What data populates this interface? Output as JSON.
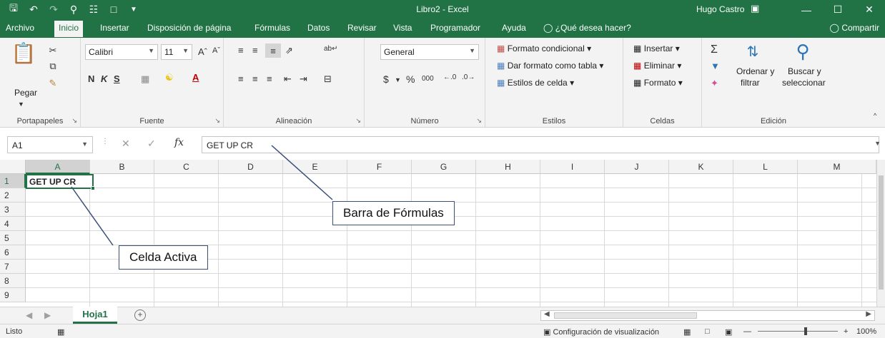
{
  "window": {
    "title": "Libro2  -  Excel",
    "user": "Hugo Castro",
    "controls": [
      "—",
      "☐",
      "✕"
    ]
  },
  "qat": [
    "🖫",
    "↶",
    "↷",
    "⌖",
    "🔍",
    "🗋",
    "⏷"
  ],
  "tabs": [
    {
      "label": "Archivo",
      "active": false
    },
    {
      "label": "Inicio",
      "active": true
    },
    {
      "label": "Insertar",
      "active": false
    },
    {
      "label": "Disposición de página",
      "active": false
    },
    {
      "label": "Fórmulas",
      "active": false
    },
    {
      "label": "Datos",
      "active": false
    },
    {
      "label": "Revisar",
      "active": false
    },
    {
      "label": "Vista",
      "active": false
    },
    {
      "label": "Programador",
      "active": false
    },
    {
      "label": "Ayuda",
      "active": false
    }
  ],
  "tell_me": "¿Qué desea hacer?",
  "share": "Compartir",
  "ribbon": {
    "clipboard": {
      "label": "Portapapeles",
      "paste": "Pegar"
    },
    "font": {
      "label": "Fuente",
      "name": "Calibri",
      "size": "11",
      "bold": "N",
      "italic": "K",
      "underline": "S"
    },
    "alignment": {
      "label": "Alineación"
    },
    "number": {
      "label": "Número",
      "format": "General",
      "currency": "$",
      "percent": "%",
      "thousands": "000",
      "inc_dec": "⁺⁰₀₀",
      "dec_dec": "⁰₀→⁰"
    },
    "styles": {
      "label": "Estilos",
      "conditional": "Formato condicional",
      "as_table": "Dar formato como tabla",
      "cell_styles": "Estilos de celda"
    },
    "cells": {
      "label": "Celdas",
      "insert": "Insertar",
      "delete": "Eliminar",
      "format": "Formato"
    },
    "editing": {
      "label": "Edición",
      "sort_1": "Ordenar y",
      "sort_2": "filtrar",
      "find_1": "Buscar y",
      "find_2": "seleccionar"
    }
  },
  "formula_bar": {
    "name_box": "A1",
    "fx": "fx",
    "content": "GET UP CR"
  },
  "columns": [
    "A",
    "B",
    "C",
    "D",
    "E",
    "F",
    "G",
    "H",
    "I",
    "J",
    "K",
    "L",
    "M"
  ],
  "rows": [
    "1",
    "2",
    "3",
    "4",
    "5",
    "6",
    "7",
    "8",
    "9"
  ],
  "cells": {
    "A1": "GET UP CR"
  },
  "sheets": {
    "active": "Hoja1"
  },
  "status": {
    "mode": "Listo",
    "display_settings": "Configuración de visualización",
    "zoom": "100%"
  },
  "annotations": {
    "formula_bar": "Barra de Fórmulas",
    "active_cell": "Celda Activa"
  }
}
